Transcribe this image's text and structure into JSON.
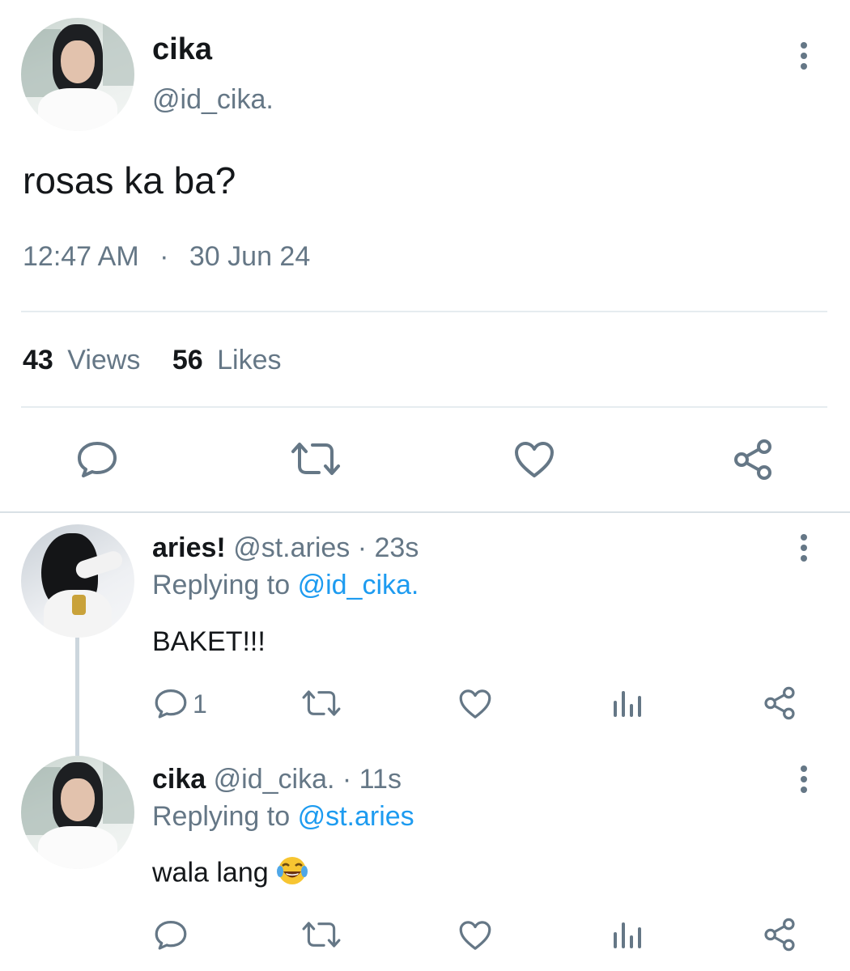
{
  "main_tweet": {
    "display_name": "cika",
    "handle": "@id_cika.",
    "text": "rosas ka ba?",
    "time": "12:47 AM",
    "separator": "·",
    "date": "30 Jun 24",
    "views_count": "43",
    "views_label": "Views",
    "likes_count": "56",
    "likes_label": "Likes"
  },
  "replies": [
    {
      "display_name": "aries!",
      "handle": "@st.aries",
      "time": "· 23s",
      "replying_prefix": "Replying to",
      "replying_handle": "@id_cika.",
      "text": "BAKET!!!",
      "reply_count": "1"
    },
    {
      "display_name": "cika",
      "handle": "@id_cika.",
      "time": "· 11s",
      "replying_prefix": "Replying to",
      "replying_handle": "@st.aries",
      "text": "wala lang",
      "emoji": "face-with-tears-of-joy"
    }
  ],
  "colors": {
    "text": "#14171a",
    "secondary": "#657786",
    "accent": "#1d9bf0",
    "divider": "#e6ecf0"
  },
  "icons": [
    "comment-icon",
    "retweet-icon",
    "heart-icon",
    "share-icon",
    "analytics-icon",
    "more-icon"
  ]
}
